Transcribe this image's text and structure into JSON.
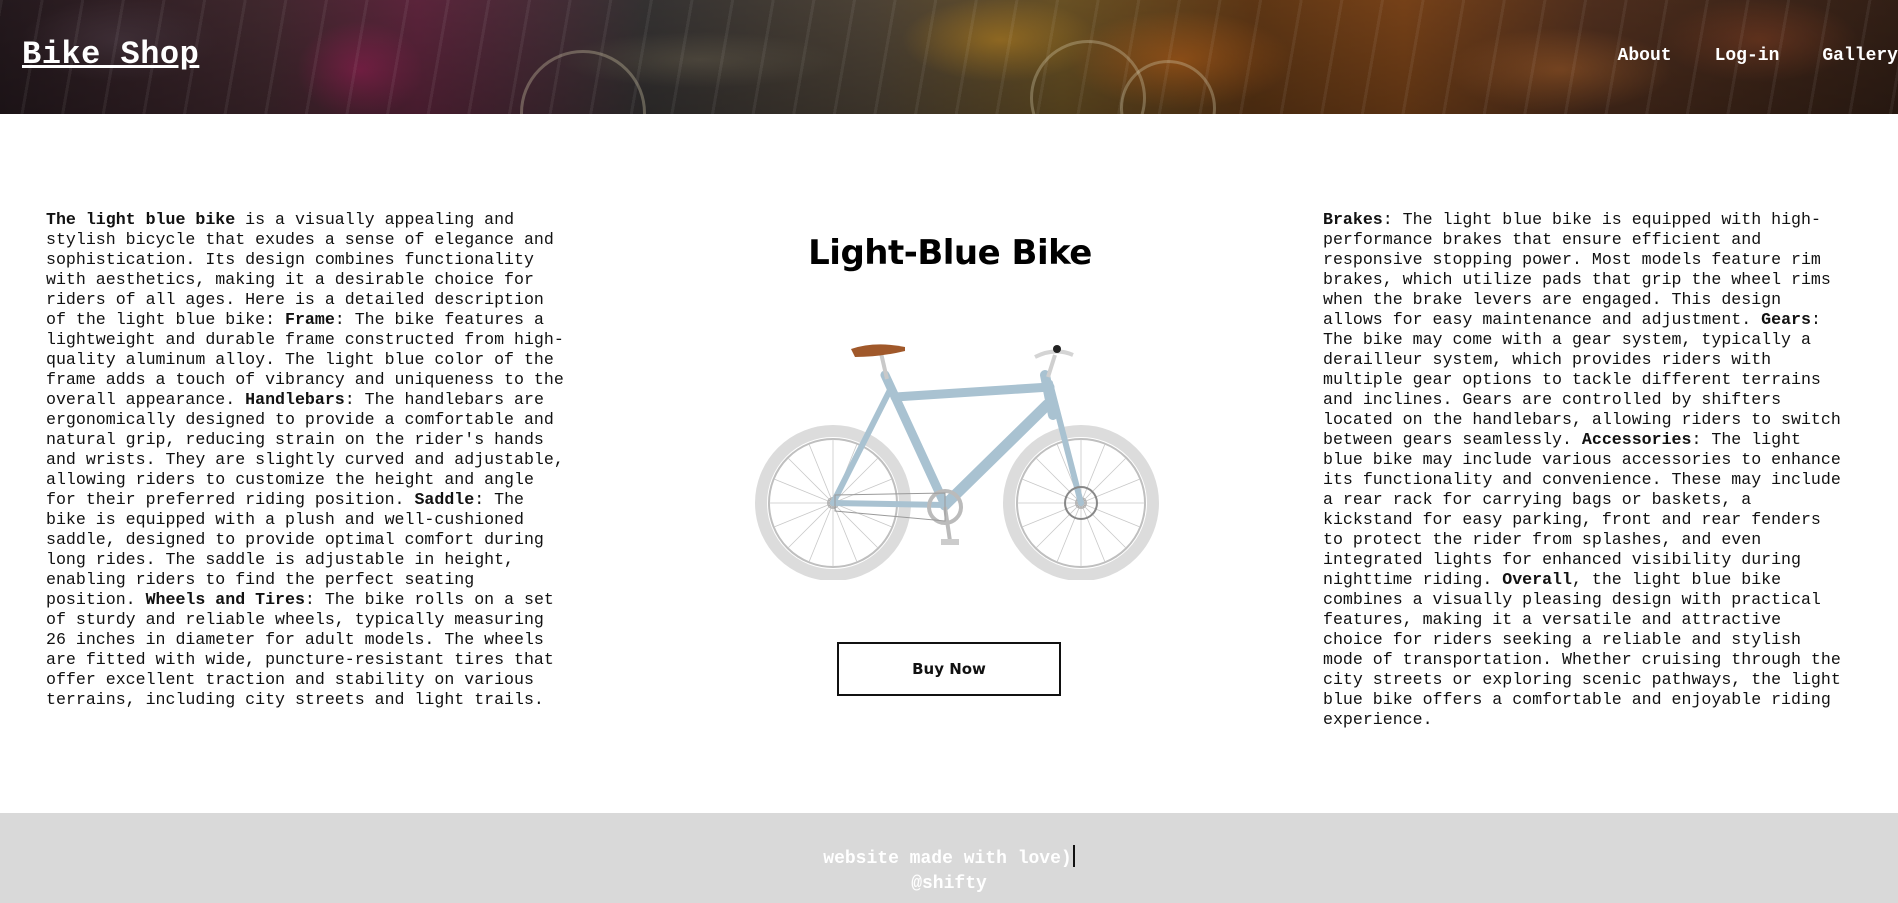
{
  "header": {
    "logo": "Bike Shop",
    "nav": [
      "About",
      "Log-in",
      "Gallery"
    ]
  },
  "main": {
    "title": "Light-Blue Bike",
    "buy_button": "Buy Now",
    "bike_image": "light-blue-bicycle",
    "left_text": [
      {
        "b": "The light blue bike",
        "t": " is a visually appealing and stylish bicycle that exudes a sense of elegance and sophistication. Its design combines functionality with aesthetics, making it a desirable choice for riders of all ages. Here is a detailed description of the light blue bike: "
      },
      {
        "b": "Frame",
        "t": ": The bike features a lightweight and durable frame constructed from high-quality aluminum alloy. The light blue color of the frame adds a touch of vibrancy and uniqueness to the overall appearance. "
      },
      {
        "b": "Handlebars",
        "t": ": The handlebars are ergonomically designed to provide a comfortable and natural grip, reducing strain on the rider's hands and wrists. They are slightly curved and adjustable, allowing riders to customize the height and angle for their preferred riding position. "
      },
      {
        "b": "Saddle",
        "t": ": The bike is equipped with a plush and well-cushioned saddle, designed to provide optimal comfort during long rides. The saddle is adjustable in height, enabling riders to find the perfect seating position. "
      },
      {
        "b": "Wheels and Tires",
        "t": ": The bike rolls on a set of sturdy and reliable wheels, typically measuring 26 inches in diameter for adult models. The wheels are fitted with wide, puncture-resistant tires that offer excellent traction and stability on various terrains, including city streets and light trails."
      }
    ],
    "right_text": [
      {
        "b": "Brakes",
        "t": ": The light blue bike is equipped with high-performance brakes that ensure efficient and responsive stopping power. Most models feature rim brakes, which utilize pads that grip the wheel rims when the brake levers are engaged. This design allows for easy maintenance and adjustment. "
      },
      {
        "b": "Gears",
        "t": ": The bike may come with a gear system, typically a derailleur system, which provides riders with multiple gear options to tackle different terrains and inclines. Gears are controlled by shifters located on the handlebars, allowing riders to switch between gears seamlessly. "
      },
      {
        "b": "Accessories",
        "t": ": The light blue bike may include various accessories to enhance its functionality and convenience. These may include a rear rack for carrying bags or baskets, a kickstand for easy parking, front and rear fenders to protect the rider from splashes, and even integrated lights for enhanced visibility during nighttime riding. "
      },
      {
        "b": "Overall",
        "t": ", the light blue bike combines a visually pleasing design with practical features, making it a versatile and attractive choice for riders seeking a reliable and stylish mode of transportation. Whether cruising through the city streets or exploring scenic pathways, the light blue bike offers a comfortable and enjoyable riding experience."
      }
    ]
  },
  "footer": {
    "line1": "website made with love)",
    "line2": "@shifty"
  },
  "colors": {
    "footer_bg": "#d9d9d9",
    "frame_blue": "#a9c2d1",
    "saddle_brown": "#a0582a"
  }
}
